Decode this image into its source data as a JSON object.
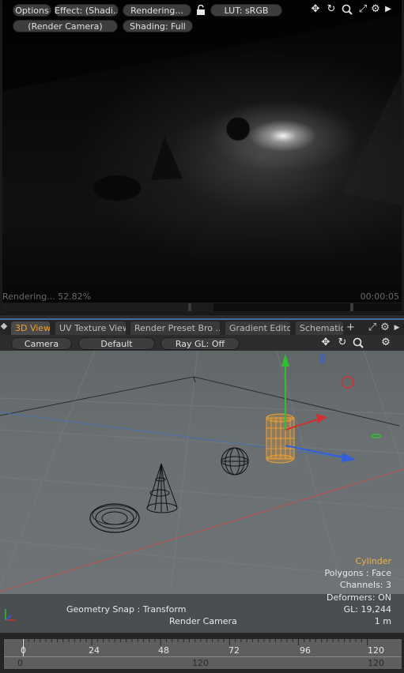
{
  "render_panel": {
    "options_label": "Options",
    "effect_label": "Effect: (Shadi...",
    "rendering_label": "Rendering...",
    "lut_label": "LUT: sRGB",
    "camera_label": "(Render Camera)",
    "shading_label": "Shading: Full",
    "status_text": "Rendering... 52.82%",
    "progress": 0.5282,
    "elapsed_time": "00:00:05"
  },
  "tabs": [
    {
      "label": "3D View",
      "active": true
    },
    {
      "label": "UV Texture View"
    },
    {
      "label": "Render Preset Bro ..."
    },
    {
      "label": "Gradient Editor"
    },
    {
      "label": "Schematic"
    }
  ],
  "tab_add": "+",
  "view_toolbar": {
    "camera_label": "Camera",
    "default_label": "Default",
    "raygl_label": "Ray GL: Off"
  },
  "viewport_info": {
    "selected_item": "Cylinder",
    "polygons": "Polygons : Face",
    "channels": "Channels: 3",
    "deformers": "Deformers: ON",
    "gl": "GL: 19,244",
    "scale": "1 m",
    "snap": "Geometry Snap : Transform",
    "camera": "Render Camera"
  },
  "timeline": {
    "upper_labels": [
      "0",
      "24",
      "48",
      "72",
      "96",
      "120"
    ],
    "lower_labels": [
      "0",
      "120",
      "120"
    ]
  },
  "colors": {
    "accent_tab": "#f0a030",
    "selected_item": "#f0b040",
    "tab_border": "#3b6e9c"
  },
  "icons": [
    "move-icon",
    "rotate-icon",
    "zoom-icon",
    "maximize-icon",
    "gear-icon",
    "arrow-right-icon",
    "lock-icon"
  ]
}
